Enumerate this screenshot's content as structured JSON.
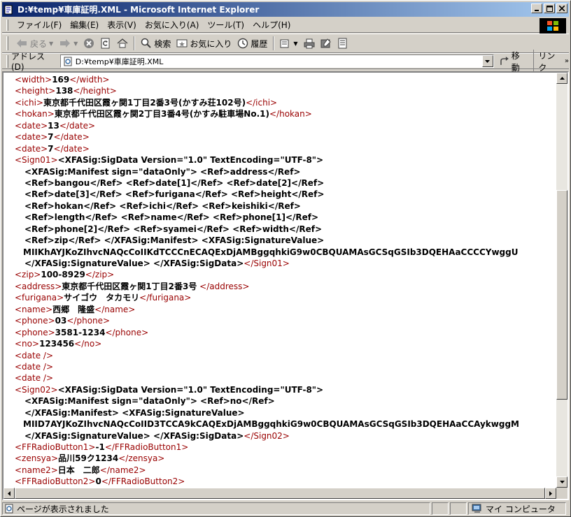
{
  "window": {
    "title": "D:¥temp¥車庫証明.XML - Microsoft Internet Explorer"
  },
  "menu": [
    "ファイル(F)",
    "編集(E)",
    "表示(V)",
    "お気に入り(A)",
    "ツール(T)",
    "ヘルプ(H)"
  ],
  "toolbar": {
    "back": "戻る",
    "search": "検索",
    "favorites": "お気に入り",
    "history": "履歴"
  },
  "address": {
    "label": "アドレス(D)",
    "value": "D:¥temp¥車庫証明.XML",
    "go": "移動",
    "links": "リンク"
  },
  "xml_lines": [
    {
      "indent": 0,
      "parts": [
        [
          "t",
          "<width>"
        ],
        [
          "x",
          "169"
        ],
        [
          "t",
          "</width>"
        ]
      ]
    },
    {
      "indent": 0,
      "parts": [
        [
          "t",
          "<height>"
        ],
        [
          "x",
          "138"
        ],
        [
          "t",
          "</height>"
        ]
      ]
    },
    {
      "indent": 0,
      "parts": [
        [
          "t",
          "<ichi>"
        ],
        [
          "x",
          "東京都千代田区霞ヶ関1丁目2番3号(かすみ荘102号)"
        ],
        [
          "t",
          "</ichi>"
        ]
      ]
    },
    {
      "indent": 0,
      "parts": [
        [
          "t",
          "<hokan>"
        ],
        [
          "x",
          "東京都千代田区霞ヶ関2丁目3番4号(かすみ駐車場No.1)"
        ],
        [
          "t",
          "</hokan>"
        ]
      ]
    },
    {
      "indent": 0,
      "parts": [
        [
          "t",
          "<date>"
        ],
        [
          "x",
          "13"
        ],
        [
          "t",
          "</date>"
        ]
      ]
    },
    {
      "indent": 0,
      "parts": [
        [
          "t",
          "<date>"
        ],
        [
          "x",
          "7"
        ],
        [
          "t",
          "</date>"
        ]
      ]
    },
    {
      "indent": 0,
      "parts": [
        [
          "t",
          "<date>"
        ],
        [
          "x",
          "7"
        ],
        [
          "t",
          "</date>"
        ]
      ]
    },
    {
      "indent": 0,
      "parts": [
        [
          "t",
          "<Sign01>"
        ],
        [
          "x",
          "<XFASig:SigData Version=\"1.0\" TextEncoding=\"UTF-8\">"
        ]
      ]
    },
    {
      "indent": 1,
      "parts": [
        [
          "x",
          "<XFASig:Manifest sign=\"dataOnly\"> <Ref>address</Ref>"
        ]
      ]
    },
    {
      "indent": 1,
      "parts": [
        [
          "x",
          "<Ref>bangou</Ref> <Ref>date[1]</Ref> <Ref>date[2]</Ref>"
        ]
      ]
    },
    {
      "indent": 1,
      "parts": [
        [
          "x",
          "<Ref>date[3]</Ref> <Ref>furigana</Ref> <Ref>height</Ref>"
        ]
      ]
    },
    {
      "indent": 1,
      "parts": [
        [
          "x",
          "<Ref>hokan</Ref> <Ref>ichi</Ref> <Ref>keishiki</Ref>"
        ]
      ]
    },
    {
      "indent": 1,
      "parts": [
        [
          "x",
          "<Ref>length</Ref> <Ref>name</Ref> <Ref>phone[1]</Ref>"
        ]
      ]
    },
    {
      "indent": 1,
      "parts": [
        [
          "x",
          "<Ref>phone[2]</Ref> <Ref>syamei</Ref> <Ref>width</Ref>"
        ]
      ]
    },
    {
      "indent": 1,
      "parts": [
        [
          "x",
          "<Ref>zip</Ref> </XFASig:Manifest> <XFASig:SignatureValue>"
        ]
      ]
    },
    {
      "indent": 2,
      "parts": [
        [
          "x",
          "MIIKhAYJKoZIhvcNAQcCoIIKdTCCCnECAQExDjAMBggqhkiG9w0CBQUAMAsGCSqGSIb3DQEHAaCCCCYwggU"
        ]
      ]
    },
    {
      "indent": 1,
      "parts": [
        [
          "x",
          "</XFASig:SignatureValue> </XFASig:SigData>"
        ],
        [
          "t",
          "</Sign01>"
        ]
      ]
    },
    {
      "indent": 0,
      "parts": [
        [
          "t",
          "<zip>"
        ],
        [
          "x",
          "100-8929"
        ],
        [
          "t",
          "</zip>"
        ]
      ]
    },
    {
      "indent": 0,
      "parts": [
        [
          "t",
          "<address>"
        ],
        [
          "x",
          "東京都千代田区霞ヶ関1丁目2番3号"
        ],
        [
          "t",
          " </address>"
        ]
      ]
    },
    {
      "indent": 0,
      "parts": [
        [
          "t",
          "<furigana>"
        ],
        [
          "x",
          "サイゴウ　タカモリ"
        ],
        [
          "t",
          "</furigana>"
        ]
      ]
    },
    {
      "indent": 0,
      "parts": [
        [
          "t",
          "<name>"
        ],
        [
          "x",
          "西郷　隆盛"
        ],
        [
          "t",
          "</name>"
        ]
      ]
    },
    {
      "indent": 0,
      "parts": [
        [
          "t",
          "<phone>"
        ],
        [
          "x",
          "03"
        ],
        [
          "t",
          "</phone>"
        ]
      ]
    },
    {
      "indent": 0,
      "parts": [
        [
          "t",
          "<phone>"
        ],
        [
          "x",
          "3581-1234"
        ],
        [
          "t",
          "</phone>"
        ]
      ]
    },
    {
      "indent": 0,
      "parts": [
        [
          "t",
          "<no>"
        ],
        [
          "x",
          "123456"
        ],
        [
          "t",
          "</no>"
        ]
      ]
    },
    {
      "indent": 0,
      "parts": [
        [
          "t",
          "<date />"
        ]
      ]
    },
    {
      "indent": 0,
      "parts": [
        [
          "t",
          "<date />"
        ]
      ]
    },
    {
      "indent": 0,
      "parts": [
        [
          "t",
          "<date />"
        ]
      ]
    },
    {
      "indent": 0,
      "parts": [
        [
          "t",
          "<Sign02>"
        ],
        [
          "x",
          "<XFASig:SigData Version=\"1.0\" TextEncoding=\"UTF-8\">"
        ]
      ]
    },
    {
      "indent": 1,
      "parts": [
        [
          "x",
          "<XFASig:Manifest sign=\"dataOnly\"> <Ref>no</Ref>"
        ]
      ]
    },
    {
      "indent": 1,
      "parts": [
        [
          "x",
          "</XFASig:Manifest> <XFASig:SignatureValue>"
        ]
      ]
    },
    {
      "indent": 2,
      "parts": [
        [
          "x",
          "MIID7AYJKoZIhvcNAQcCoIID3TCCA9kCAQExDjAMBggqhkiG9w0CBQUAMAsGCSqGSIb3DQEHAaCCAykwggM"
        ]
      ]
    },
    {
      "indent": 1,
      "parts": [
        [
          "x",
          "</XFASig:SignatureValue> </XFASig:SigData>"
        ],
        [
          "t",
          "</Sign02>"
        ]
      ]
    },
    {
      "indent": 0,
      "parts": [
        [
          "t",
          "<FFRadioButton1>"
        ],
        [
          "x",
          "-1"
        ],
        [
          "t",
          "</FFRadioButton1>"
        ]
      ]
    },
    {
      "indent": 0,
      "parts": [
        [
          "t",
          "<zensya>"
        ],
        [
          "x",
          "品川59ク1234"
        ],
        [
          "t",
          "</zensya>"
        ]
      ]
    },
    {
      "indent": 0,
      "parts": [
        [
          "t",
          "<name2>"
        ],
        [
          "x",
          "日本　二郎"
        ],
        [
          "t",
          "</name2>"
        ]
      ]
    },
    {
      "indent": 0,
      "parts": [
        [
          "t",
          "<FFRadioButton2>"
        ],
        [
          "x",
          "0"
        ],
        [
          "t",
          "</FFRadioButton2>"
        ]
      ]
    }
  ],
  "status": {
    "message": "ページが表示されました",
    "zone": "マイ コンピュータ"
  },
  "icons": {
    "app": "ie-page-icon",
    "minimize": "minimize-icon",
    "maximize": "maximize-icon",
    "close": "close-icon",
    "back": "back-arrow-icon",
    "forward": "forward-arrow-icon",
    "stop": "stop-icon",
    "refresh": "refresh-icon",
    "home": "home-icon",
    "search": "search-icon",
    "favorites": "favorites-icon",
    "history": "history-icon",
    "mail": "mail-icon",
    "print": "print-icon",
    "edit": "edit-icon",
    "discuss": "discuss-icon",
    "go": "go-arrow-icon",
    "zone": "my-computer-icon",
    "brand": "windows-logo-icon"
  }
}
